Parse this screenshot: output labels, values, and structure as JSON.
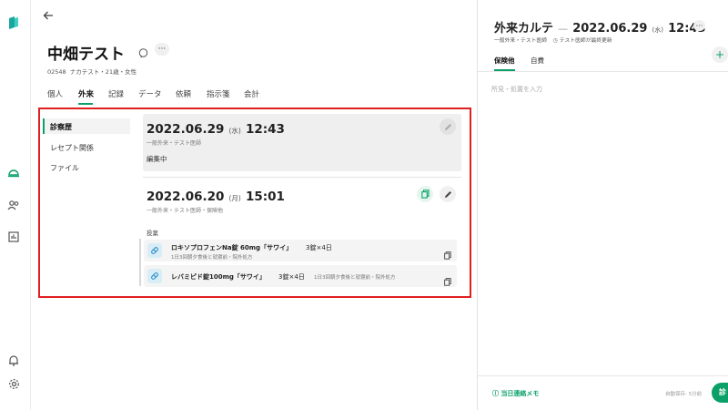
{
  "patient": {
    "name": "中畑テスト",
    "meta": "02548  ナカテスト・21歳・女性"
  },
  "tabs": [
    "個人",
    "外来",
    "記録",
    "データ",
    "依頼",
    "指示箋",
    "会計"
  ],
  "subnav": [
    "診察歴",
    "レセプト関係",
    "ファイル"
  ],
  "visit1": {
    "date": "2022.06.29",
    "weekday": "(水)",
    "time": "12:43",
    "sub": "一般外来・テスト医師",
    "status": "編集中"
  },
  "visit2": {
    "date": "2022.06.20",
    "weekday": "(月)",
    "time": "15:01",
    "sub": "一般外来・テスト医師・保険他",
    "section_label": "投薬",
    "meds": [
      {
        "name": "ロキソプロフェンNa錠 60mg「サワイ」",
        "qty": "3錠×4日",
        "detail": "1日3回朝夕食後と就寝前・院外処方"
      },
      {
        "name": "レバミピド錠100mg「サワイ」",
        "qty": "3錠×4日",
        "detail": "1日3回朝夕食後と就寝前・院外処方"
      }
    ]
  },
  "right": {
    "title": "外来カルテ",
    "sep": "—",
    "date": "2022.06.29",
    "weekday": "(水)",
    "time": "12:43",
    "sub1": "一般外来・テスト医師",
    "sub2": "テスト医師が最終更新",
    "tabs": [
      "保険他",
      "自費"
    ],
    "placeholder": "所見・処置を入力",
    "memo": "当日連絡メモ",
    "autosave": "自動保存: 5分前",
    "save_btn_partial": "診"
  },
  "colors": {
    "accent": "#0aa068",
    "frame": "#e02020",
    "logo": "#19a7a0"
  }
}
